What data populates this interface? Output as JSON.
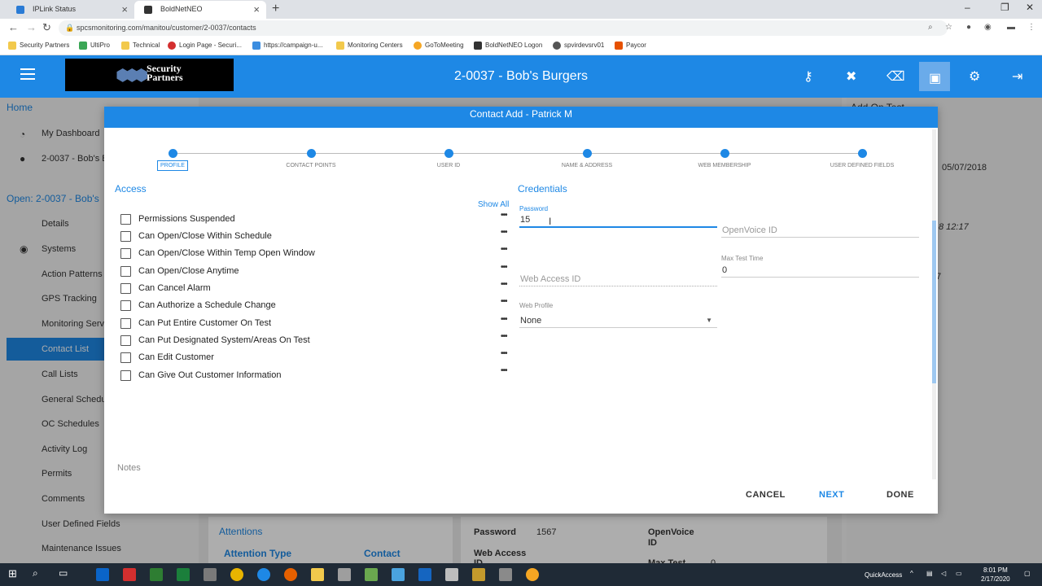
{
  "browser": {
    "tabs": [
      {
        "label": "IPLink Status",
        "icon_color": "#2a7bd5"
      },
      {
        "label": "BoldNetNEO",
        "icon_color": "#333333"
      }
    ],
    "url": "spcsmonitoring.com/manitou/customer/2-0037/contacts",
    "bookmarks": [
      {
        "label": "Security Partners",
        "icon_color": "#f2c94c"
      },
      {
        "label": "UltiPro",
        "icon_color": "#3aa655"
      },
      {
        "label": "Technical",
        "icon_color": "#f2c94c"
      },
      {
        "label": "Login Page - Securi...",
        "icon_color": "#d32f2f"
      },
      {
        "label": "https://campaign-u...",
        "icon_color": "#3b8de0"
      },
      {
        "label": "Monitoring Centers",
        "icon_color": "#f2c94c"
      },
      {
        "label": "GoToMeeting",
        "icon_color": "#f5a623"
      },
      {
        "label": "BoldNetNEO Logon",
        "icon_color": "#333333"
      },
      {
        "label": "spvirdevsrv01",
        "icon_color": "#555555"
      },
      {
        "label": "Paycor",
        "icon_color": "#e65100"
      }
    ]
  },
  "header": {
    "logo_line1": "Security",
    "logo_line2": "Partners",
    "title": "2-0037 - Bob's Burgers",
    "accent": "#1e88e5"
  },
  "sidebar": {
    "home": "Home",
    "dashboard": "My Dashboard",
    "customer": "2-0037 - Bob's B",
    "open": "Open: 2-0037 - Bob's",
    "items": [
      "Details",
      "Systems",
      "Action Patterns",
      "GPS Tracking",
      "Monitoring Serv",
      "Contact List",
      "Call Lists",
      "General Schedu",
      "OC Schedules",
      "Activity Log",
      "Permits",
      "Comments",
      "User Defined Fields",
      "Maintenance Issues"
    ]
  },
  "background": {
    "add_on_test": "Add On Test",
    "date": "05/07/2018",
    "time": "8 12:17",
    "seven": "7",
    "attentions": "Attentions",
    "attention_type": "Attention Type",
    "contact": "Contact",
    "password_label": "Password",
    "password_value": "1567",
    "openvoice_label": "OpenVoice",
    "openvoice_label2": "ID",
    "web_access": "Web Access",
    "web_access2": "ID",
    "max_test": "Max Test",
    "zero": "0"
  },
  "modal": {
    "title": "Contact Add - Patrick M",
    "steps": [
      "PROFILE",
      "CONTACT POINTS",
      "USER ID",
      "NAME & ADDRESS",
      "WEB MEMBERSHIP",
      "USER DEFINED FIELDS"
    ],
    "access_title": "Access",
    "show_all": "Show All",
    "permissions": [
      "Permissions Suspended",
      "Can Open/Close Within Schedule",
      "Can Open/Close Within Temp Open Window",
      "Can Open/Close Anytime",
      "Can Cancel Alarm",
      "Can Authorize a Schedule Change",
      "Can Put Entire Customer On Test",
      "Can Put Designated System/Areas On Test",
      "Can Edit Customer",
      "Can Give Out Customer Information"
    ],
    "more_glyph": "•••",
    "credentials_title": "Credentials",
    "password_label": "Password",
    "password_value": "15",
    "openvoice_placeholder": "OpenVoice ID",
    "web_access_placeholder": "Web Access ID",
    "max_test_label": "Max Test Time",
    "max_test_value": "0",
    "web_profile_label": "Web Profile",
    "web_profile_value": "None",
    "notes": "Notes",
    "buttons": {
      "cancel": "CANCEL",
      "next": "NEXT",
      "done": "DONE"
    }
  },
  "taskbar": {
    "quickaccess": "QuickAccess",
    "time": "8:01 PM",
    "date": "2/17/2020"
  }
}
